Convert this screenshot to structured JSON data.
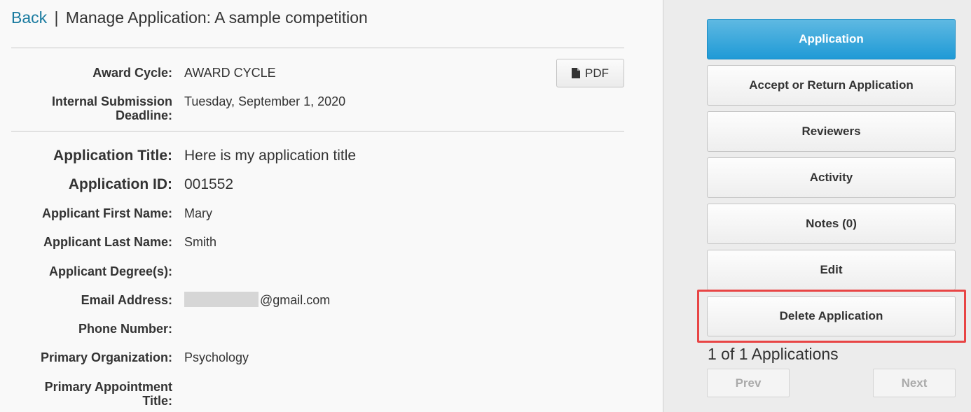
{
  "header": {
    "back_label": "Back",
    "separator": "|",
    "title": "Manage Application: A sample competition"
  },
  "pdf_button": {
    "label": "PDF",
    "icon": "file-icon"
  },
  "details": {
    "award_cycle": {
      "label": "Award Cycle:",
      "value": "AWARD CYCLE"
    },
    "deadline": {
      "label_line1": "Internal Submission",
      "label_line2": "Deadline:",
      "value": "Tuesday, September 1, 2020"
    },
    "application_title": {
      "label": "Application Title:",
      "value": "Here is my application title"
    },
    "application_id": {
      "label": "Application ID:",
      "value": "001552"
    },
    "first_name": {
      "label": "Applicant First Name:",
      "value": "Mary"
    },
    "last_name": {
      "label": "Applicant Last Name:",
      "value": "Smith"
    },
    "degrees": {
      "label": "Applicant Degree(s):",
      "value": ""
    },
    "email": {
      "label": "Email Address:",
      "value_suffix": "@gmail.com"
    },
    "phone": {
      "label": "Phone Number:",
      "value": ""
    },
    "organization": {
      "label": "Primary Organization:",
      "value": "Psychology"
    },
    "appointment": {
      "label_line1": "Primary Appointment",
      "label_line2": "Title:",
      "value": ""
    }
  },
  "sidebar": {
    "buttons": [
      {
        "label": "Application",
        "active": true
      },
      {
        "label": "Accept or Return Application",
        "active": false
      },
      {
        "label": "Reviewers",
        "active": false
      },
      {
        "label": "Activity",
        "active": false
      },
      {
        "label": "Notes (0)",
        "active": false
      },
      {
        "label": "Edit",
        "active": false
      },
      {
        "label": "Delete Application",
        "active": false,
        "highlighted": true
      }
    ],
    "count_text": "1 of 1 Applications",
    "prev_label": "Prev",
    "next_label": "Next"
  },
  "colors": {
    "link": "#1a7ba0",
    "active_button": "#1f9ad6",
    "highlight": "#e84545"
  }
}
